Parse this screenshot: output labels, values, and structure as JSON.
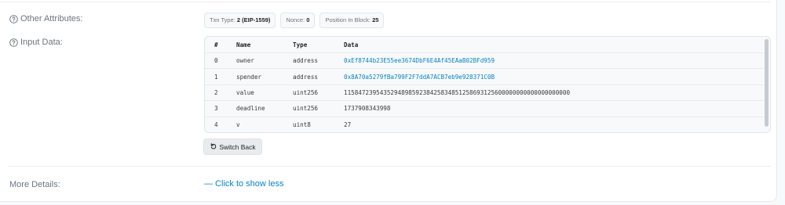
{
  "other_attributes": {
    "label": "Other Attributes:",
    "chips": [
      {
        "key": "Txn Type:",
        "value": "2 (EIP-1559)"
      },
      {
        "key": "Nonce:",
        "value": "0"
      },
      {
        "key": "Position In Block:",
        "value": "25"
      }
    ]
  },
  "input_data": {
    "label": "Input Data:",
    "headers": [
      "#",
      "Name",
      "Type",
      "Data"
    ],
    "rows": [
      {
        "idx": "0",
        "name": "owner",
        "type": "address",
        "data": "0xEf8744b23E55ee3674DbF6E4Af45EAaB02BFd959",
        "is_link": true
      },
      {
        "idx": "1",
        "name": "spender",
        "type": "address",
        "data": "0x8A70a5279fBa799F2F7ddA7ACB7eb9e928371C0B",
        "is_link": true
      },
      {
        "idx": "2",
        "name": "value",
        "type": "uint256",
        "data": "115847239543529489859238425834851258693125600000000000000000000",
        "is_link": false
      },
      {
        "idx": "3",
        "name": "deadline",
        "type": "uint256",
        "data": "1737908343998",
        "is_link": false
      },
      {
        "idx": "4",
        "name": "v",
        "type": "uint8",
        "data": "27",
        "is_link": false
      }
    ],
    "switch_button": "Switch Back"
  },
  "more_details": {
    "label": "More Details:",
    "toggle": "— Click to show less"
  },
  "colors": {
    "link": "#0784c3",
    "label": "#6c757d"
  }
}
